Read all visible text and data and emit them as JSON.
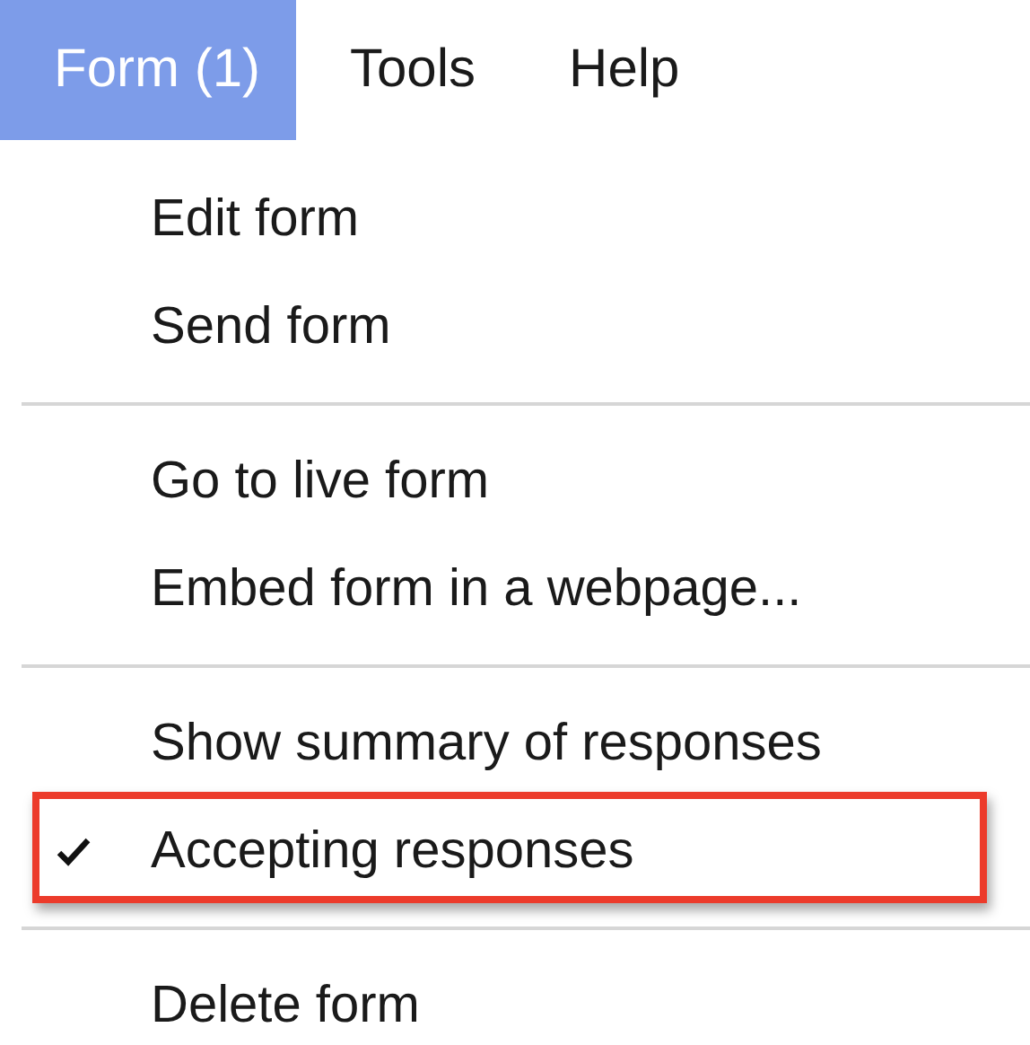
{
  "menubar": [
    {
      "label": "Form (1)",
      "selected": true
    },
    {
      "label": "Tools",
      "selected": false
    },
    {
      "label": "Help",
      "selected": false
    }
  ],
  "menu": {
    "sections": [
      {
        "items": [
          {
            "label": "Edit form",
            "checked": false,
            "highlighted": false
          },
          {
            "label": "Send form",
            "checked": false,
            "highlighted": false
          }
        ]
      },
      {
        "items": [
          {
            "label": "Go to live form",
            "checked": false,
            "highlighted": false
          },
          {
            "label": "Embed form in a webpage...",
            "checked": false,
            "highlighted": false
          }
        ]
      },
      {
        "items": [
          {
            "label": "Show summary of responses",
            "checked": false,
            "highlighted": false
          },
          {
            "label": "Accepting responses",
            "checked": true,
            "highlighted": true
          }
        ]
      },
      {
        "items": [
          {
            "label": "Delete form",
            "checked": false,
            "highlighted": false
          }
        ]
      }
    ]
  }
}
